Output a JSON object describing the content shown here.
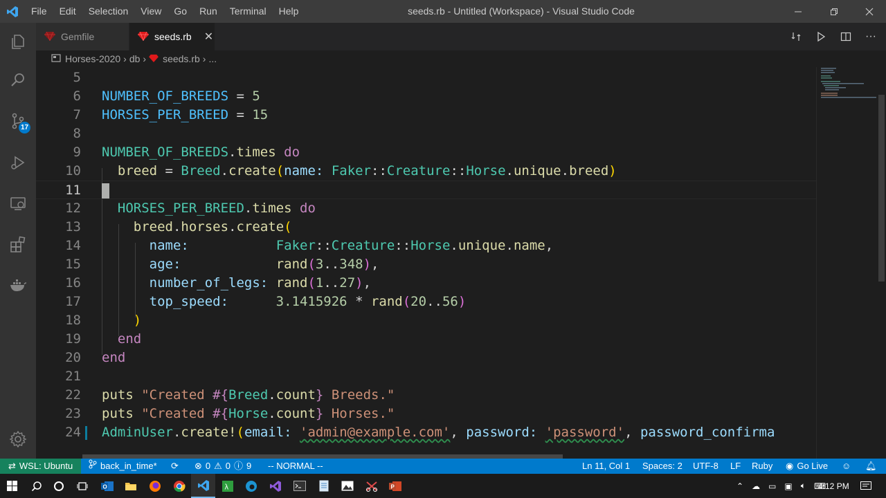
{
  "window": {
    "title": "seeds.rb - Untitled (Workspace) - Visual Studio Code",
    "menu": [
      "File",
      "Edit",
      "Selection",
      "View",
      "Go",
      "Run",
      "Terminal",
      "Help"
    ]
  },
  "activity_bar": {
    "icons": [
      "explorer-icon",
      "search-icon",
      "source-control-icon",
      "run-debug-icon",
      "remote-explorer-icon",
      "extensions-icon",
      "docker-icon",
      "settings-gear-icon"
    ],
    "source_control_badge": "17"
  },
  "tabs": [
    {
      "label": "Gemfile",
      "active": false
    },
    {
      "label": "seeds.rb",
      "active": true
    }
  ],
  "breadcrumb": [
    "Horses-2020",
    "db",
    "seeds.rb",
    "..."
  ],
  "editor": {
    "line_numbers": [
      "5",
      "6",
      "7",
      "8",
      "9",
      "10",
      "11",
      "12",
      "13",
      "14",
      "15",
      "16",
      "17",
      "18",
      "19",
      "20",
      "21",
      "22",
      "23",
      "24"
    ],
    "current_line": "11"
  },
  "status_bar": {
    "remote": "WSL: Ubuntu",
    "branch": "back_in_time*",
    "errors": "0",
    "warnings": "0",
    "info": "9",
    "mode": "-- NORMAL --",
    "position": "Ln 11, Col 1",
    "spaces": "Spaces: 2",
    "encoding": "UTF-8",
    "eol": "LF",
    "language": "Ruby",
    "go_live": "Go Live"
  },
  "taskbar": {
    "time": "4:12 PM"
  },
  "colors": {
    "accent": "#007acc",
    "remote": "#16825d",
    "editor_bg": "#1e1e1e"
  }
}
